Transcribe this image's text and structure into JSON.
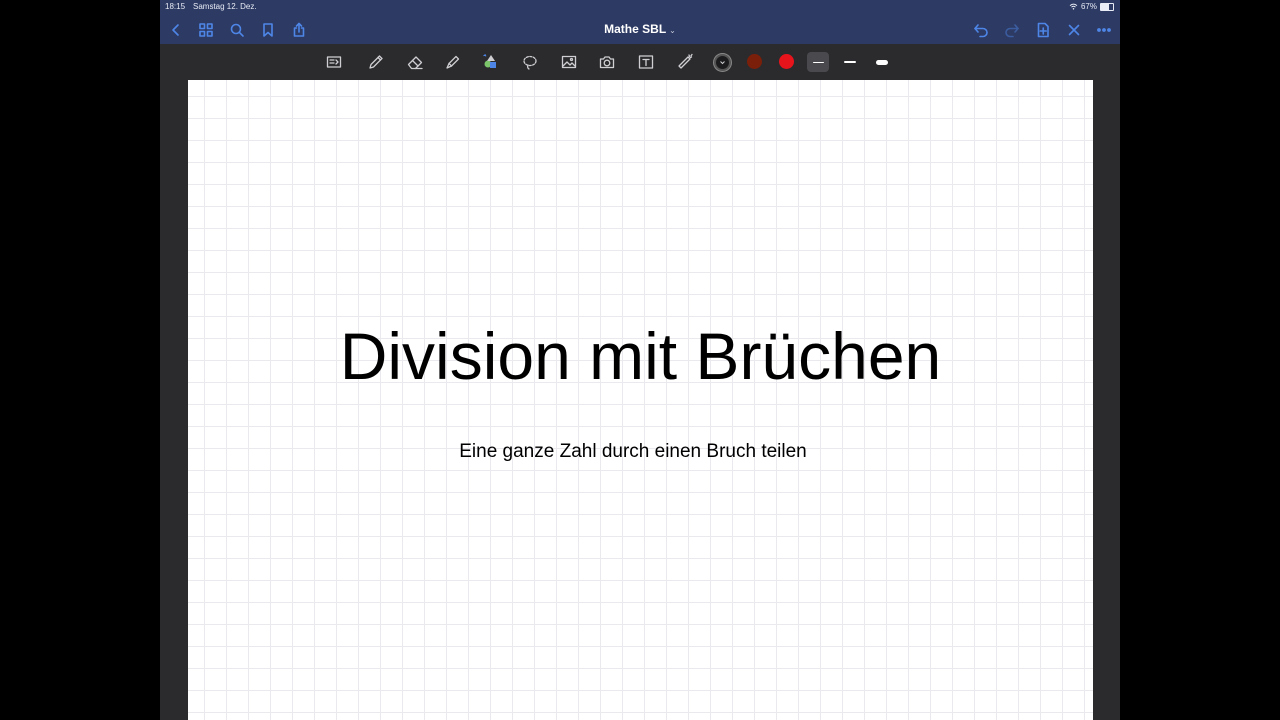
{
  "status_bar": {
    "time": "18:15",
    "date": "Samstag 12. Dez.",
    "battery": "67%",
    "wifi_icon": "wifi-icon",
    "battery_level": 0.67
  },
  "nav": {
    "title": "Mathe SBL",
    "title_chevron": "⌄",
    "left_icons": [
      "back-icon",
      "grid-icon",
      "search-icon",
      "bookmark-icon",
      "share-icon"
    ],
    "right_icons": [
      "undo-icon",
      "redo-icon",
      "add-page-icon",
      "close-icon",
      "more-icon"
    ]
  },
  "toolbar": {
    "tools": [
      "read-only-icon",
      "pen-icon",
      "eraser-icon",
      "highlighter-icon",
      "shapes-icon",
      "lasso-icon",
      "image-icon",
      "camera-icon",
      "text-icon",
      "laser-pointer-icon"
    ],
    "colors": [
      "#1c1c1e",
      "#7a1f0a",
      "#e8141c"
    ],
    "selected_color": "#1c1c1e",
    "stroke_widths": [
      "thin",
      "medium",
      "thick"
    ],
    "selected_stroke": "thin"
  },
  "page": {
    "title": "Division mit Brüchen",
    "subtitle": "Eine ganze Zahl durch einen Bruch teilen"
  }
}
